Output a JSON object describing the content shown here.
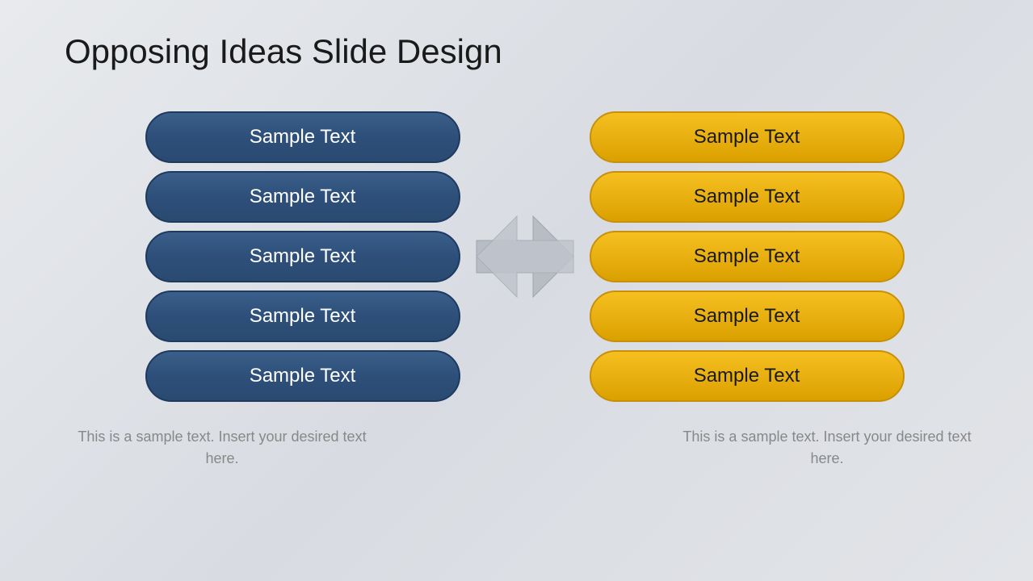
{
  "slide": {
    "title": "Opposing Ideas Slide Design",
    "left_pills": [
      "Sample Text",
      "Sample Text",
      "Sample Text",
      "Sample Text",
      "Sample Text"
    ],
    "right_pills": [
      "Sample Text",
      "Sample Text",
      "Sample Text",
      "Sample Text",
      "Sample Text"
    ],
    "bottom_text_left": "This is a sample text. Insert your desired text here.",
    "bottom_text_right": "This is a sample text. Insert your desired text here.",
    "colors": {
      "blue": "#2d4f7a",
      "yellow": "#f0b400",
      "arrow": "#b0b4bb",
      "text_white": "#ffffff",
      "text_dark": "#1a1a1a",
      "text_caption": "#888888"
    }
  }
}
